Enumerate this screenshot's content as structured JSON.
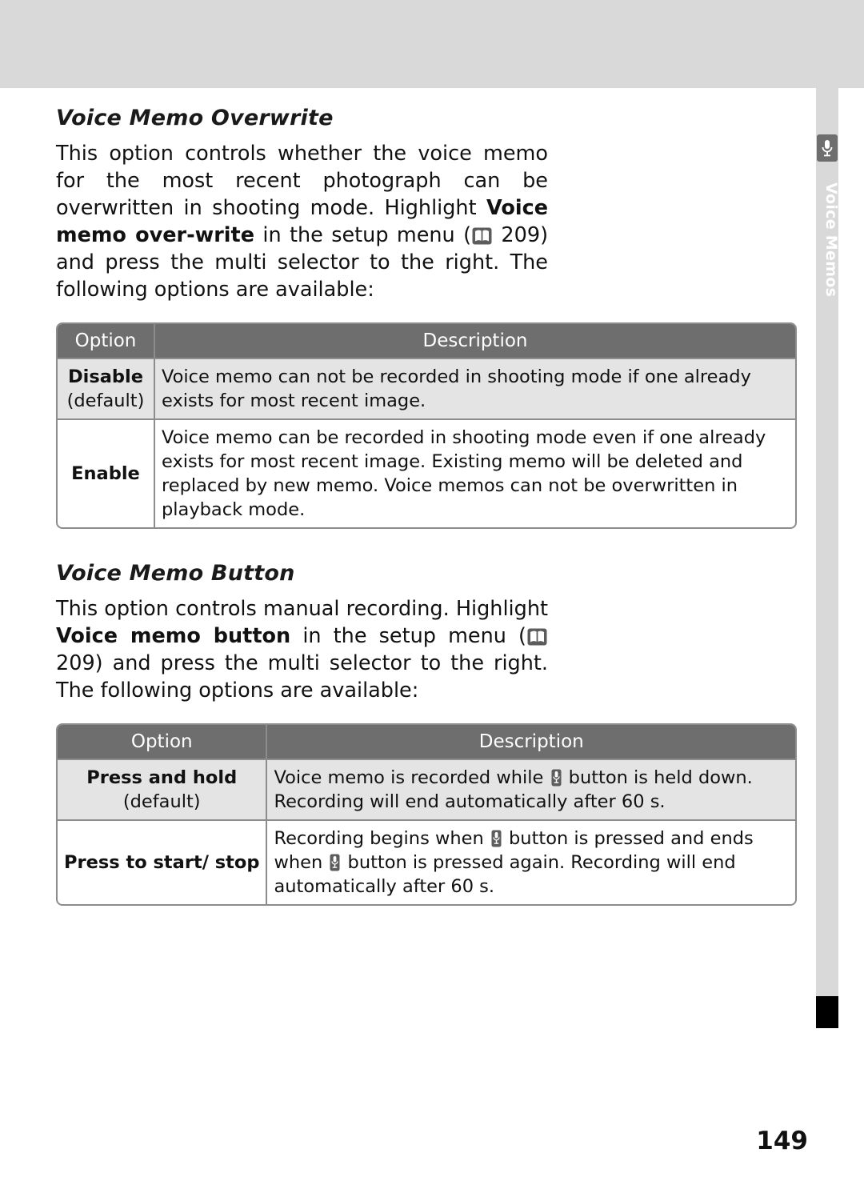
{
  "page": {
    "number": "149",
    "side_tab_label": "Voice Memos",
    "side_tab_icon": "microphone-icon"
  },
  "sections": [
    {
      "id": "voice-memo-overwrite",
      "title": "Voice Memo Overwrite",
      "paragraph_parts": {
        "p1": "This option controls whether the voice memo for the most recent photograph can be overwritten in shooting mode.  Highlight ",
        "bold1": "Voice memo over-write",
        "p2": " in the setup menu (",
        "page_ref": "209",
        "p3": ") and press the multi selector to the right.  The following options are available:"
      },
      "table": {
        "headers": [
          "Option",
          "Description"
        ],
        "rows": [
          {
            "option": "Disable",
            "option_note": "(default)",
            "description": "Voice memo can not be recorded in shooting mode if one already exists for most recent image.",
            "shaded": true
          },
          {
            "option": "Enable",
            "option_note": "",
            "description": "Voice memo can be recorded in shooting mode even if one already exists for most recent image.  Existing memo will be deleted and replaced by new memo.  Voice memos can not be overwritten in playback mode.",
            "shaded": false
          }
        ]
      }
    },
    {
      "id": "voice-memo-button",
      "title": "Voice Memo Button",
      "paragraph_parts": {
        "p1": "This option controls manual recording.  Highlight ",
        "bold1": "Voice memo button",
        "p2": " in the setup menu (",
        "page_ref": "209",
        "p3": ") and press the multi selector to the right.  The following options are available:"
      },
      "table": {
        "headers": [
          "Option",
          "Description"
        ],
        "rows": [
          {
            "option": "Press and hold",
            "option_note": "(default)",
            "description_a": "Voice memo is recorded while ",
            "description_b": " button is held down.  Recording will end automatically after 60 s.",
            "shaded": true
          },
          {
            "option": "Press to start/ stop",
            "option_note": "",
            "description_a": "Recording begins when ",
            "description_b": " button is pressed and ends when ",
            "description_c": " button is pressed again.  Recording will end automatically after 60 s.",
            "shaded": false
          }
        ]
      }
    }
  ]
}
